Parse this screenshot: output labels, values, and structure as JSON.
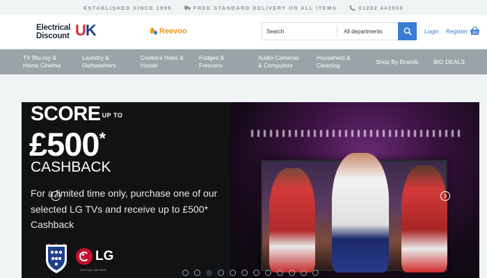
{
  "topbar": {
    "established": "ESTABLISHED SINCE 1999",
    "delivery": "FREE STANDARD DELIVERY ON ALL ITEMS",
    "phone": "01282 443850"
  },
  "header": {
    "logo_line1": "Electrical",
    "logo_line2": "Discount",
    "logo_uk_u": "U",
    "logo_uk_k": "K",
    "reevoo": "Reevoo",
    "search_placeholder": "Search",
    "department": "All departments",
    "login": "Login",
    "register": "Register"
  },
  "nav": {
    "items": [
      {
        "l1": "TV Blu-ray &",
        "l2": "Home Cinema"
      },
      {
        "l1": "Laundry &",
        "l2": "Dishwashers"
      },
      {
        "l1": "Cookers Hobs &",
        "l2": "Hoods"
      },
      {
        "l1": "Fridges &",
        "l2": "Freezers"
      },
      {
        "l1": "Audio Cameras",
        "l2": "& Computers"
      },
      {
        "l1": "Household &",
        "l2": "Cleaning"
      },
      {
        "l1": "Shop By Brands",
        "l2": ""
      },
      {
        "l1": "BIG DEALS",
        "l2": ""
      }
    ]
  },
  "hero": {
    "score": "SCORE",
    "upto": "UP TO",
    "amount": "£500",
    "asterisk": "*",
    "cashback": "CASHBACK",
    "desc": "For a limited time only, purchase one of our selected LG TVs and receive up to £500* Cashback",
    "lg": "LG",
    "official": "OFFICIAL PARTNER"
  },
  "carousel": {
    "total": 12,
    "active_index": 2
  },
  "colors": {
    "accent": "#3a7bd5",
    "nav_bg": "#9aa4a8",
    "brand_red": "#d32f3a",
    "brand_blue": "#1f3f8a"
  }
}
